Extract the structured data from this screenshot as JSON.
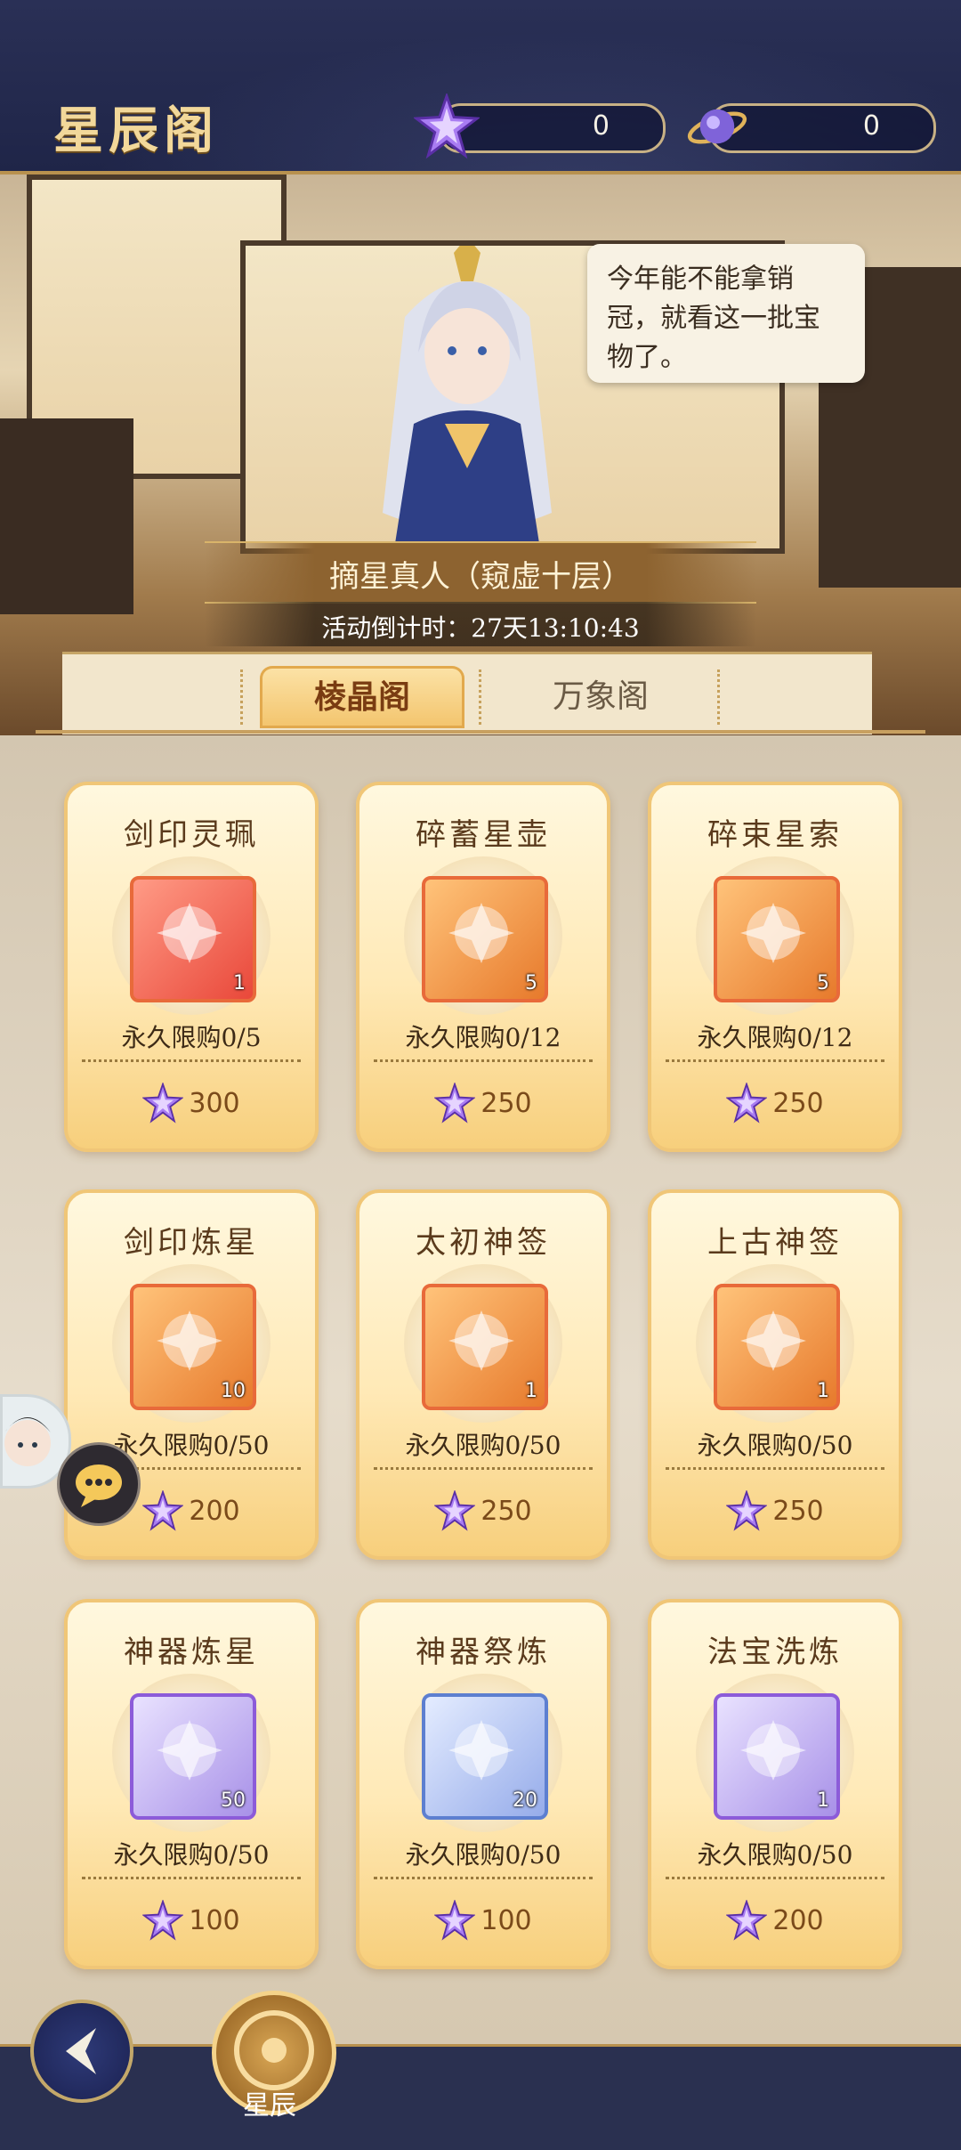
{
  "header": {
    "title": "星辰阁",
    "currency_star": {
      "icon": "purple-star-icon",
      "value": "0"
    },
    "currency_orb": {
      "icon": "planet-orb-icon",
      "value": "0"
    }
  },
  "scene": {
    "dialogue": "今年能不能拿销冠，就看这一批宝物了。",
    "npc_name": "摘星真人（窥虚十层）",
    "countdown": "活动倒计时：27天13:10:43"
  },
  "tabs": [
    {
      "label": "棱晶阁",
      "active": true
    },
    {
      "label": "万象阁",
      "active": false
    }
  ],
  "items": [
    {
      "name": "剑印灵珮",
      "qty": "1",
      "limit": "永久限购0/5",
      "price": "300",
      "style": "red"
    },
    {
      "name": "碎蓄星壶",
      "qty": "5",
      "limit": "永久限购0/12",
      "price": "250",
      "style": "orange"
    },
    {
      "name": "碎束星索",
      "qty": "5",
      "limit": "永久限购0/12",
      "price": "250",
      "style": "orange"
    },
    {
      "name": "剑印炼星",
      "qty": "10",
      "limit": "永久限购0/50",
      "price": "200",
      "style": "orange"
    },
    {
      "name": "太初神签",
      "qty": "1",
      "limit": "永久限购0/50",
      "price": "250",
      "style": "orange"
    },
    {
      "name": "上古神签",
      "qty": "1",
      "limit": "永久限购0/50",
      "price": "250",
      "style": "orange"
    },
    {
      "name": "神器炼星",
      "qty": "50",
      "limit": "永久限购0/50",
      "price": "100",
      "style": "purple"
    },
    {
      "name": "神器祭炼",
      "qty": "20",
      "limit": "永久限购0/50",
      "price": "100",
      "style": "blue"
    },
    {
      "name": "法宝洗炼",
      "qty": "1",
      "limit": "永久限购0/50",
      "price": "200",
      "style": "purple"
    }
  ],
  "bottom": {
    "back_icon": "back-arrow-icon",
    "star_button_label": "星辰"
  },
  "colors": {
    "header_bg": "#2a3056",
    "accent_gold": "#f2d89a",
    "card_gold": "#f7cf7c"
  }
}
